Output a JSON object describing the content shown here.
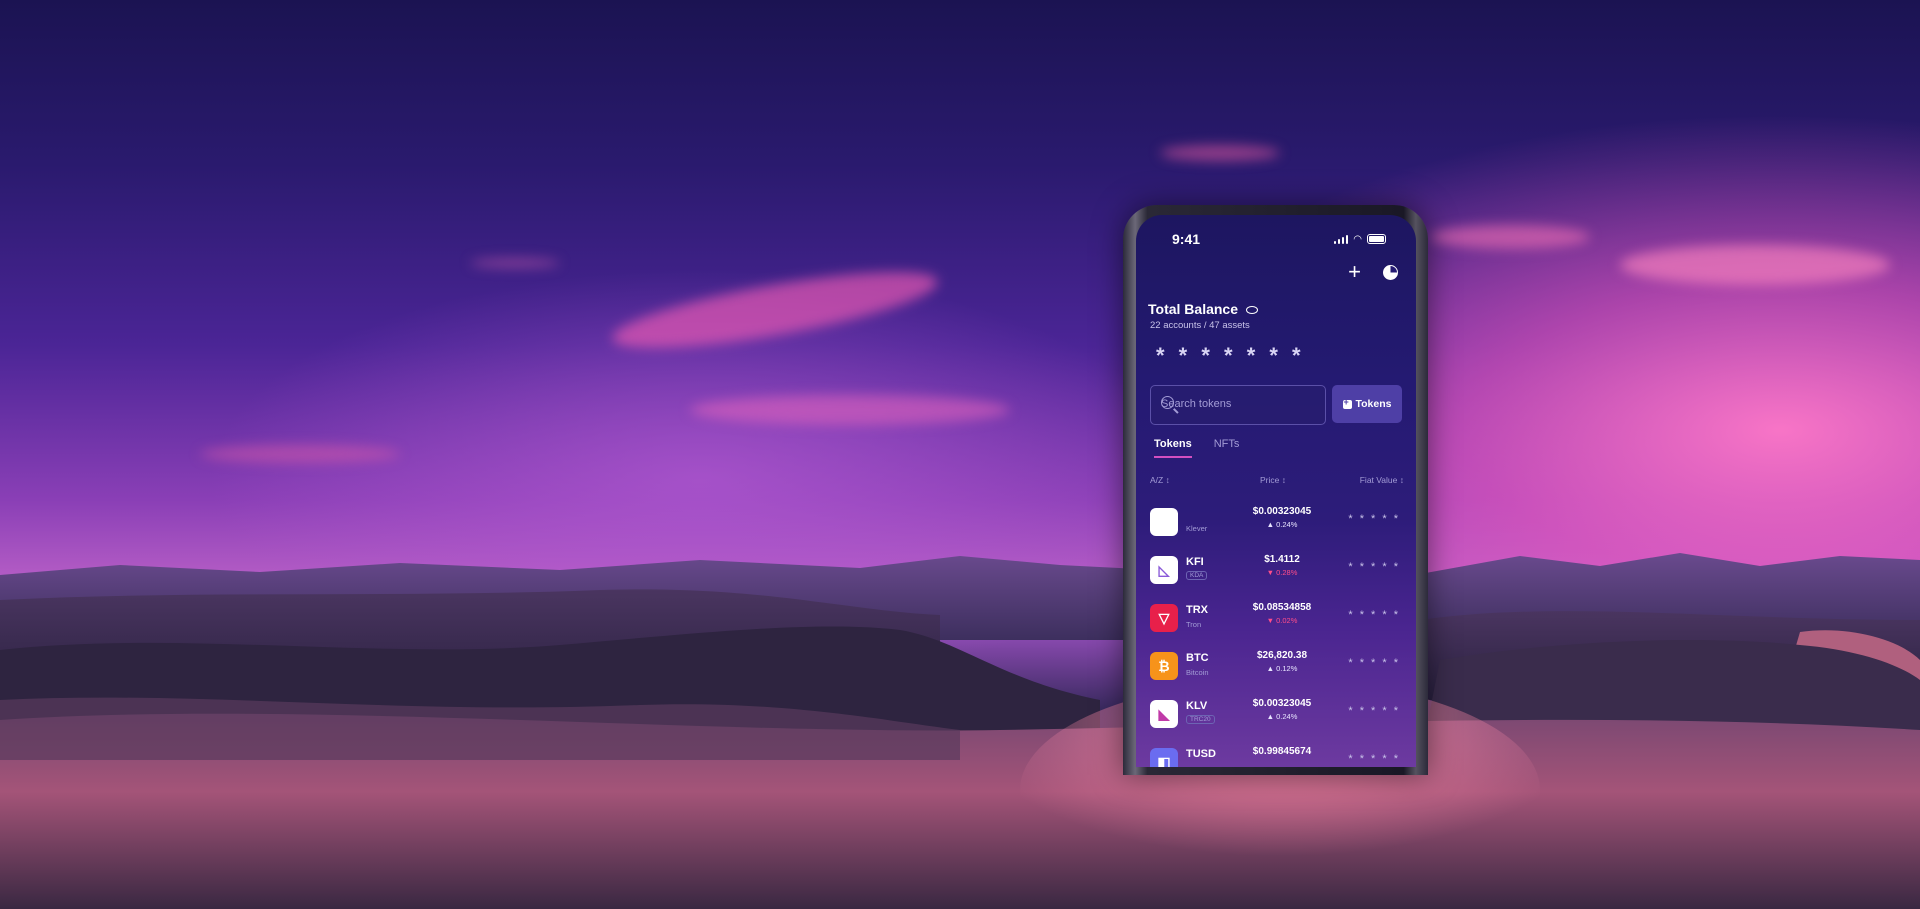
{
  "phone": {
    "status_time": "9:41",
    "balance_title": "Total Balance",
    "accounts_summary": "22 accounts / 47 assets",
    "hidden_balance": "* * * * * * *",
    "search_placeholder": "Search tokens",
    "tokens_button_label": "Tokens",
    "tabs": [
      "Tokens",
      "NFTs"
    ],
    "headers": {
      "name": "A/Z",
      "price": "Price",
      "fiat": "Fiat Value"
    },
    "rows": [
      {
        "symbol": "",
        "name": "Klever",
        "price": "$0.00323045",
        "change": "▲ 0.24%",
        "direction": "up",
        "fiat": "* * * * *",
        "icon_color": "#ffffff",
        "icon_name": "klever-icon"
      },
      {
        "symbol": "KFI",
        "name": "",
        "tag": "KDA",
        "price": "$1.4112",
        "change": "▼ 0.28%",
        "direction": "down",
        "fiat": "* * * * *",
        "icon_color": "#ffffff",
        "icon_name": "kfi-icon"
      },
      {
        "symbol": "TRX",
        "name": "Tron",
        "price": "$0.08534858",
        "change": "▼ 0.02%",
        "direction": "down",
        "fiat": "* * * * *",
        "icon_color": "#e8204a",
        "icon_name": "tron-icon"
      },
      {
        "symbol": "BTC",
        "name": "Bitcoin",
        "price": "$26,820.38",
        "change": "▲ 0.12%",
        "direction": "up",
        "fiat": "* * * * *",
        "icon_color": "#f7931a",
        "icon_name": "bitcoin-icon"
      },
      {
        "symbol": "KLV",
        "name": "",
        "tag": "TRC20",
        "price": "$0.00323045",
        "change": "▲ 0.24%",
        "direction": "up",
        "fiat": "* * * * *",
        "icon_color": "#ffffff",
        "icon_name": "klv-icon"
      },
      {
        "symbol": "TUSD",
        "name": "",
        "price": "$0.99845674",
        "change": "",
        "direction": "up",
        "fiat": "* * * * *",
        "icon_color": "#6a6cf0",
        "icon_name": "tusd-icon"
      }
    ]
  }
}
